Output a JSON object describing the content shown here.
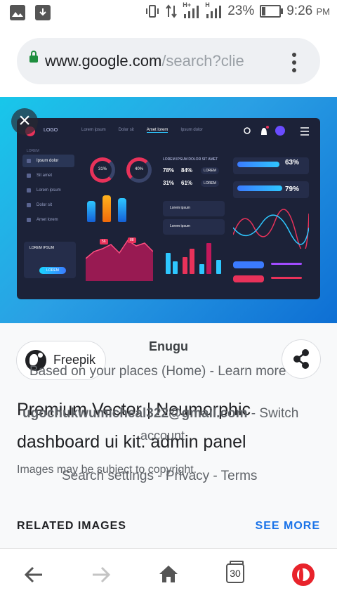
{
  "status_bar": {
    "left_icons": [
      "image-icon",
      "download-icon"
    ],
    "right_icons": [
      "vibrate-icon",
      "data-arrows-icon",
      "signal-icon",
      "signal-icon"
    ],
    "network_labels": [
      "H+",
      "H"
    ],
    "battery": "23%",
    "time": "9:26",
    "ampm": "PM"
  },
  "url_bar": {
    "domain": "www.google.com",
    "path": "/search?clie",
    "menu_icon": "more-vert-icon"
  },
  "image_preview": {
    "close_icon": "close-icon",
    "dashboard": {
      "logo": "LOGO",
      "nav": [
        "Lorem ipsum",
        "Dolor sit",
        "Amet lorem",
        "Ipsum dolor"
      ],
      "sidebar_title": "LOREM",
      "sidebar": [
        "Ipsum dolor",
        "Sit amet",
        "Lorem ipsum",
        "Dolor sit",
        "Amet lorem"
      ],
      "card_title": "LOREM IPSUM",
      "card_button": "LOREM",
      "rings": [
        "31%",
        "40%"
      ],
      "header_text": "LOREM IPSUM DOLOR SIT AMET",
      "stats": [
        "78%",
        "84%",
        "31%",
        "61%"
      ],
      "big_stats": [
        "63%",
        "79%"
      ],
      "chart_tags": [
        "56",
        "88"
      ],
      "small_buttons": [
        "LOREM",
        "LOREM"
      ],
      "list_items": [
        "Lorem ipsum",
        "Lorem ipsum"
      ]
    }
  },
  "source_chip": {
    "name": "Freepik"
  },
  "share_icon": "share-icon",
  "title": "Premium Vector | Neumorphic dashboard ui kit. admin panel",
  "copyright": "Images may be subject to copyright.",
  "overlay": {
    "location": "Enugu",
    "based_on": "Based on your places (Home) - Learn more",
    "account": "ugochukwumicheal322@gmail.com",
    "switch": " - Switch",
    "account_word": "account",
    "links": "Search settings - Privacy - Terms"
  },
  "related_label": "RELATED IMAGES",
  "see_more": "SEE MORE",
  "bottom_nav": {
    "back_icon": "back-arrow-icon",
    "forward_icon": "forward-arrow-icon",
    "home_icon": "home-icon",
    "tab_count": "30",
    "opera_icon": "opera-logo-icon"
  },
  "colors": {
    "accent": "#1a73e8",
    "secure": "#1e8e3e",
    "opera": "#e8232b",
    "dash_bg": "#1c2238",
    "image_bg": "#18c7ea"
  }
}
